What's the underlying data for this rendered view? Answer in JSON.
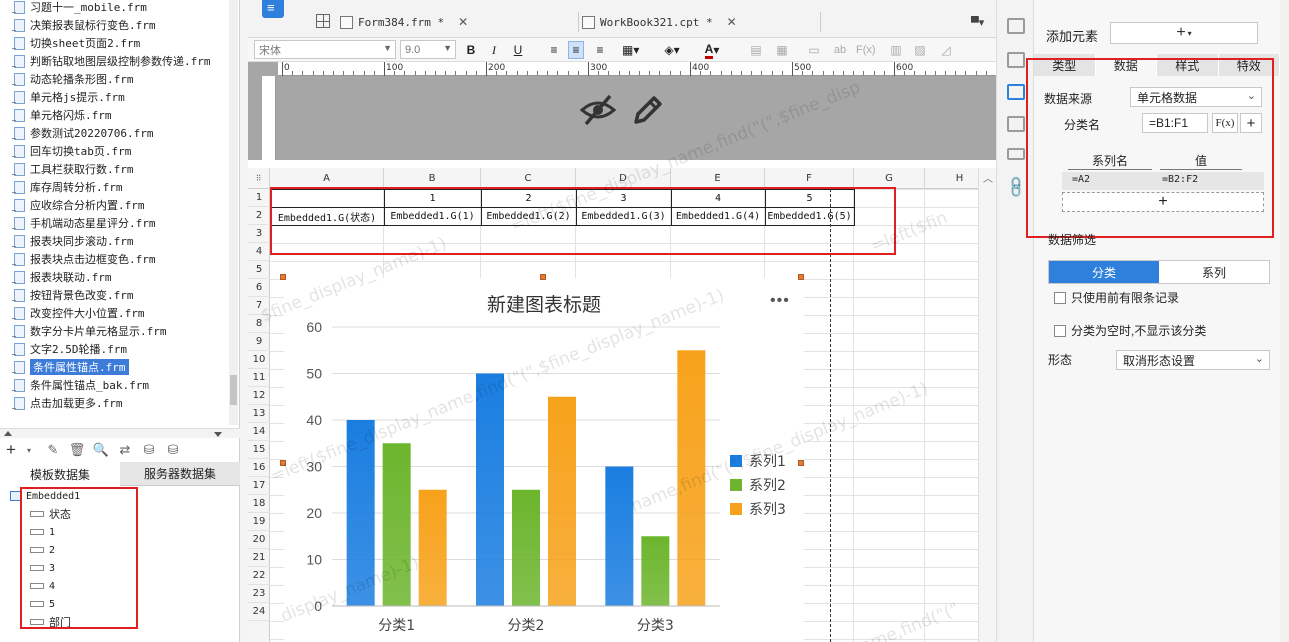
{
  "left_panel": {
    "files": [
      "习题十一_mobile.frm",
      "决策报表鼠标行变色.frm",
      "切换sheet页面2.frm",
      "判断钻取地图层级控制参数传递.frm",
      "动态轮播条形图.frm",
      "单元格js提示.frm",
      "单元格闪烁.frm",
      "参数测试20220706.frm",
      "回车切换tab页.frm",
      "工具栏获取行数.frm",
      "库存周转分析.frm",
      "应收综合分析内置.frm",
      "手机端动态星星评分.frm",
      "报表块同步滚动.frm",
      "报表块点击边框变色.frm",
      "报表块联动.frm",
      "按钮背景色改变.frm",
      "改变控件大小位置.frm",
      "数字分卡片单元格显示.frm",
      "文字2.5D轮播.frm",
      "条件属性锚点.frm",
      "条件属性锚点_bak.frm",
      "点击加载更多.frm"
    ],
    "selected_file": "条件属性锚点.frm",
    "dataset_tabs": [
      "模板数据集",
      "服务器数据集"
    ],
    "dataset_name": "Embedded1",
    "dataset_fields": [
      "状态",
      "1",
      "2",
      "3",
      "4",
      "5",
      "部门"
    ]
  },
  "editor": {
    "tabs": [
      {
        "label": "Form384.frm *"
      },
      {
        "label": "WorkBook321.cpt *"
      }
    ],
    "font_name": "宋体",
    "font_size": "9.0",
    "ruler_labels": [
      "0",
      "100",
      "200",
      "300",
      "400",
      "500",
      "600",
      "700"
    ],
    "columns": [
      "A",
      "B",
      "C",
      "D",
      "E",
      "F",
      "G",
      "H"
    ],
    "rows": [
      "1",
      "2",
      "3",
      "4",
      "5",
      "6",
      "7",
      "8",
      "9",
      "10",
      "11",
      "12",
      "13",
      "14",
      "15",
      "16",
      "17",
      "18",
      "19",
      "20",
      "21",
      "22",
      "23",
      "24"
    ],
    "row1_cells": [
      "",
      "1",
      "2",
      "3",
      "4",
      "5"
    ],
    "row2_cells": [
      "Embedded1.G(状态)",
      "Embedded1.G(1)",
      "Embedded1.G(2)",
      "Embedded1.G(3)",
      "Embedded1.G(4)",
      "Embedded1.G(5)"
    ],
    "watermark_text": [
      "=left($fine_display_name,find(\"(\",$fine_display_name)-1)",
      "=left($fine_display_name,find(\"(\",$fine_disp",
      "display_name)-1)",
      "=left($fin",
      "name,find(\"(\",$fine_display_name)-1)",
      "$fine_display_name)-1)",
      "ame,find(\"(\""
    ]
  },
  "chart_data": {
    "type": "bar",
    "title": "新建图表标题",
    "categories": [
      "分类1",
      "分类2",
      "分类3"
    ],
    "series": [
      {
        "name": "系列1",
        "values": [
          40,
          50,
          30
        ],
        "color": "#1a7ee0"
      },
      {
        "name": "系列2",
        "values": [
          35,
          25,
          15
        ],
        "color": "#6cb52d"
      },
      {
        "name": "系列3",
        "values": [
          25,
          45,
          55
        ],
        "color": "#f7a21b"
      }
    ],
    "ylim": [
      0,
      60
    ],
    "yticks": [
      0,
      10,
      20,
      30,
      40,
      50,
      60
    ],
    "grid": true,
    "legend_position": "right"
  },
  "right_panel": {
    "add_element_label": "添加元素",
    "add_symbol": "+",
    "tabs": [
      "类型",
      "数据",
      "样式",
      "特效"
    ],
    "active_tab": "数据",
    "data_source_label": "数据来源",
    "data_source_value": "单元格数据",
    "category_name_label": "分类名",
    "category_name_value": "=B1:F1",
    "fx_label": "F(x)",
    "plus_label": "+",
    "series_name_header": "系列名",
    "value_header": "值",
    "series_name_cell": "=A2",
    "value_cell": "=B2:F2",
    "filter_label": "数据筛选",
    "filter_tabs": [
      "分类",
      "系列"
    ],
    "use_first_n_label": "只使用前有限条记录",
    "hide_empty_label": "分类为空时,不显示该分类",
    "shape_label": "形态",
    "shape_value": "取消形态设置"
  },
  "colors": {
    "accent": "#2f7fdc",
    "highlight_box": "#e02020"
  }
}
